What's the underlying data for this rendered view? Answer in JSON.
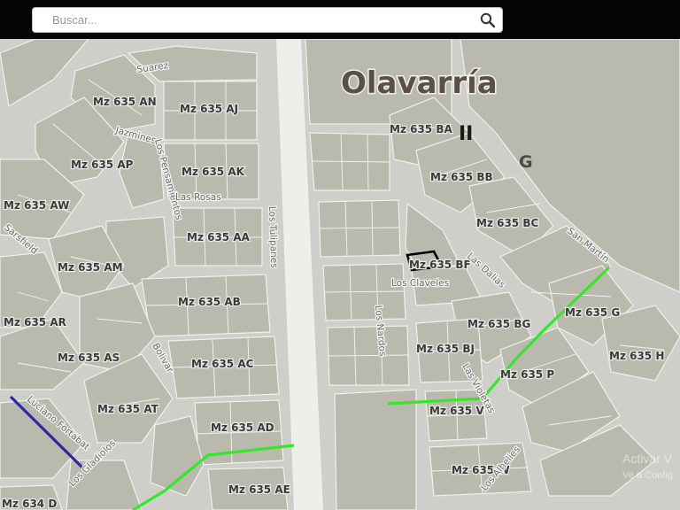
{
  "search": {
    "placeholder": "Buscar..."
  },
  "icons": {
    "search": "search-icon"
  },
  "city_label": "Olavarría",
  "marker_ii": "II",
  "marker_g": "G",
  "blocks": [
    {
      "label": "Mz 635 AN"
    },
    {
      "label": "Mz 635 AJ"
    },
    {
      "label": "Mz 635 AP"
    },
    {
      "label": "Mz 635 AK"
    },
    {
      "label": "Mz 635 AW"
    },
    {
      "label": "Mz 635 AA"
    },
    {
      "label": "Mz 635 AM"
    },
    {
      "label": "Mz 635 AB"
    },
    {
      "label": "Mz 635 AR"
    },
    {
      "label": "Mz 635 AS"
    },
    {
      "label": "Mz 635 AC"
    },
    {
      "label": "Mz 635 AT"
    },
    {
      "label": "Mz 635 AD"
    },
    {
      "label": "Mz 635 AE"
    },
    {
      "label": "Mz 634 D"
    },
    {
      "label": "Mz 635 BA"
    },
    {
      "label": "Mz 635 BB"
    },
    {
      "label": "Mz 635 BC"
    },
    {
      "label": "Mz 635 BF"
    },
    {
      "label": "Mz 635 BG"
    },
    {
      "label": "Mz 635 G"
    },
    {
      "label": "Mz 635 BJ"
    },
    {
      "label": "Mz 635 H"
    },
    {
      "label": "Mz 635 P"
    },
    {
      "label": "Mz 635 V"
    },
    {
      "label": "Mz 635 W"
    }
  ],
  "streets": [
    {
      "name": "Suarez"
    },
    {
      "name": "Jazmines"
    },
    {
      "name": "Los Pensamientos"
    },
    {
      "name": "Las Rosas"
    },
    {
      "name": "Los Tulipanes"
    },
    {
      "name": "Sarsfield"
    },
    {
      "name": "Bolivar"
    },
    {
      "name": "Luciano Fortabat"
    },
    {
      "name": "Los Gladiolos"
    },
    {
      "name": "Las Dalias"
    },
    {
      "name": "San Martín"
    },
    {
      "name": "Los Claveles"
    },
    {
      "name": "Los Nardos"
    },
    {
      "name": "Las Violetas"
    },
    {
      "name": "Los Alhelies"
    }
  ],
  "watermark": {
    "title": "Activar V",
    "subtitle": "Ve a Config"
  },
  "colors": {
    "route_green": "#35e62d",
    "route_blue": "#2a2aa0",
    "highlight": "#000000",
    "block": "#b9b9ad",
    "street": "#f0f0ec",
    "background": "#cfcfc9"
  }
}
